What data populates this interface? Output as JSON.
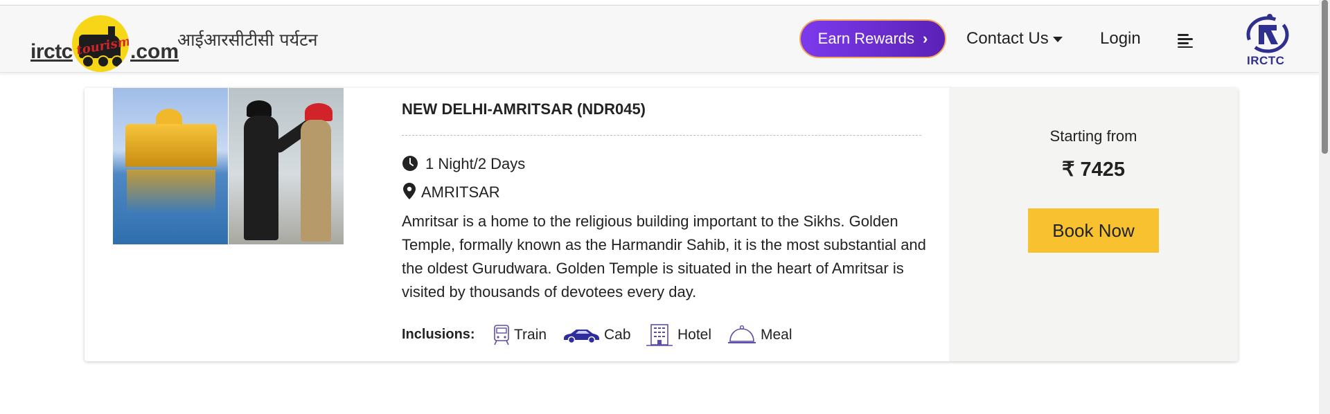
{
  "header": {
    "logo": {
      "text_left": "irctc",
      "script_text": "tourism",
      "text_right": ".com",
      "hindi_name": "आईआरसीटीसी पर्यटन"
    },
    "earn_rewards_label": "Earn Rewards",
    "earn_rewards_chevron": "›",
    "contact_label": "Contact Us",
    "login_label": "Login",
    "irctc_logo_text": "IRCTC"
  },
  "package": {
    "title": "NEW DELHI-AMRITSAR (NDR045)",
    "duration": "1 Night/2 Days",
    "location": "AMRITSAR",
    "description": "Amritsar is a home to the religious building important to the Sikhs. Golden Temple, formally known as the Harmandir Sahib, it is the most substantial and the oldest Gurudwara. Golden Temple is situated in the heart of Amritsar is visited by thousands of devotees every day.",
    "inclusions_label": "Inclusions:",
    "inclusions": [
      {
        "label": "Train",
        "icon": "train-icon"
      },
      {
        "label": "Cab",
        "icon": "car-icon"
      },
      {
        "label": "Hotel",
        "icon": "hotel-icon"
      },
      {
        "label": "Meal",
        "icon": "meal-icon"
      }
    ],
    "starting_from_label": "Starting from",
    "price": "₹ 7425",
    "book_label": "Book Now"
  },
  "colors": {
    "accent_purple": "#6d28d9",
    "book_yellow": "#f7c130",
    "icon_purple": "#5b4fa8"
  }
}
